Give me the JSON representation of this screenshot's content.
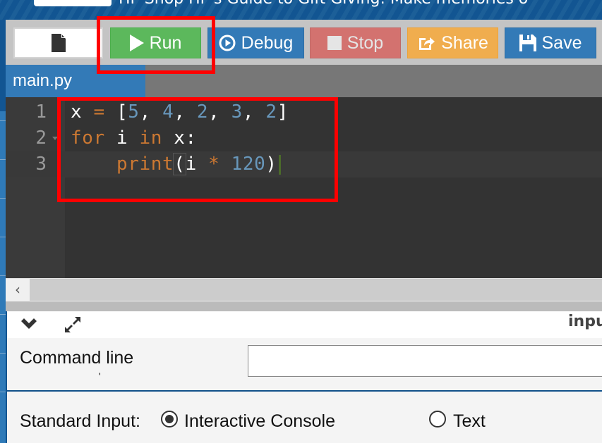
{
  "header": {
    "text": "HP  Shop HP's Guide to Gift Giving: Make memories o"
  },
  "toolbar": {
    "file_icon": "file-icon",
    "run_label": "Run",
    "run_icon": "play-icon",
    "debug_label": "Debug",
    "debug_icon": "play-circle-icon",
    "stop_label": "Stop",
    "stop_icon": "stop-icon",
    "share_label": "Share",
    "share_icon": "share-icon",
    "save_label": "Save",
    "save_icon": "floppy-disk-icon",
    "colors": {
      "run": "#5cb85c",
      "debug": "#337ab7",
      "stop": "#d9534f",
      "share": "#f0ad4e",
      "save": "#337ab7"
    }
  },
  "tabs": [
    {
      "label": "main.py",
      "active": true
    }
  ],
  "editor": {
    "active_line": 3,
    "lines": [
      {
        "number": "1",
        "code": "x = [5, 4, 2, 3, 2]"
      },
      {
        "number": "2",
        "code": "for i in x:",
        "foldable": true
      },
      {
        "number": "3",
        "code": "    print(i * 120)"
      }
    ]
  },
  "scrollbar": {
    "left_arrow": "‹"
  },
  "io_panel": {
    "collapse_icon": "chevron-down-icon",
    "expand_icon": "expand-arrows-icon",
    "title": "input",
    "command_line_label": "Command line",
    "command_line_label_cont": "'",
    "command_line_value": "",
    "standard_input_label": "Standard Input:",
    "stdin_options": [
      {
        "label": "Interactive Console",
        "checked": true
      },
      {
        "label": "Text",
        "checked": false
      }
    ]
  },
  "annotations": {
    "color": "#ff0000",
    "boxes": [
      "run-button",
      "code-editor-lines"
    ]
  }
}
